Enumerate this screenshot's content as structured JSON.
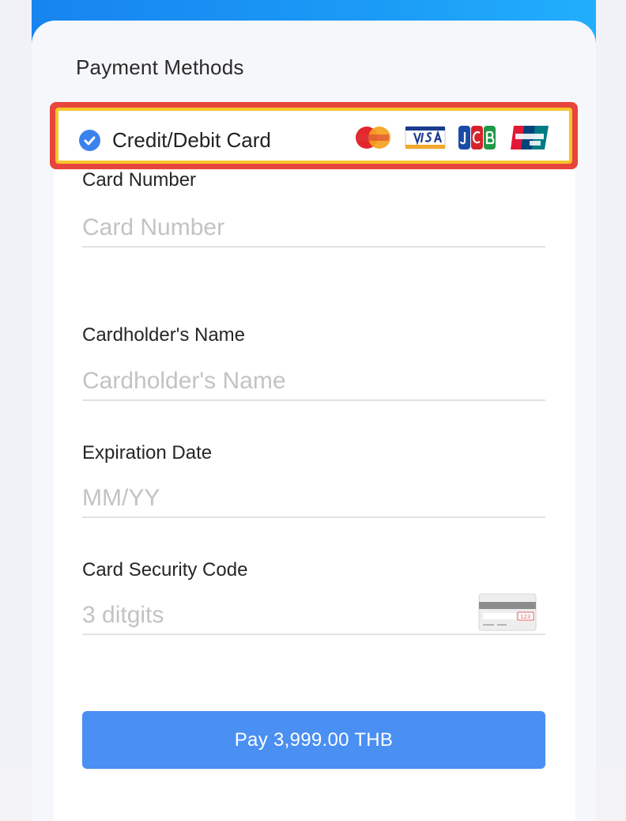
{
  "colors": {
    "banner": "#1a9bf6",
    "highlight_outer": "#e8453c",
    "highlight_inner": "#f7c52a",
    "check": "#3b82ee",
    "pay_button": "#4a8ff2"
  },
  "section": {
    "title": "Payment Methods"
  },
  "method": {
    "label": "Credit/Debit Card",
    "selected": true,
    "logos": [
      "mastercard-icon",
      "visa-icon",
      "jcb-icon",
      "unionpay-icon"
    ]
  },
  "fields": {
    "card_number": {
      "label": "Card Number",
      "placeholder": "Card Number",
      "value": ""
    },
    "cardholder": {
      "label": "Cardholder's Name",
      "placeholder": "Cardholder's Name",
      "value": ""
    },
    "expiration": {
      "label": "Expiration Date",
      "placeholder": "MM/YY",
      "value": ""
    },
    "security": {
      "label": "Card Security Code",
      "placeholder": "3 ditgits",
      "value": ""
    }
  },
  "pay_button": {
    "label": "Pay 3,999.00 THB"
  }
}
